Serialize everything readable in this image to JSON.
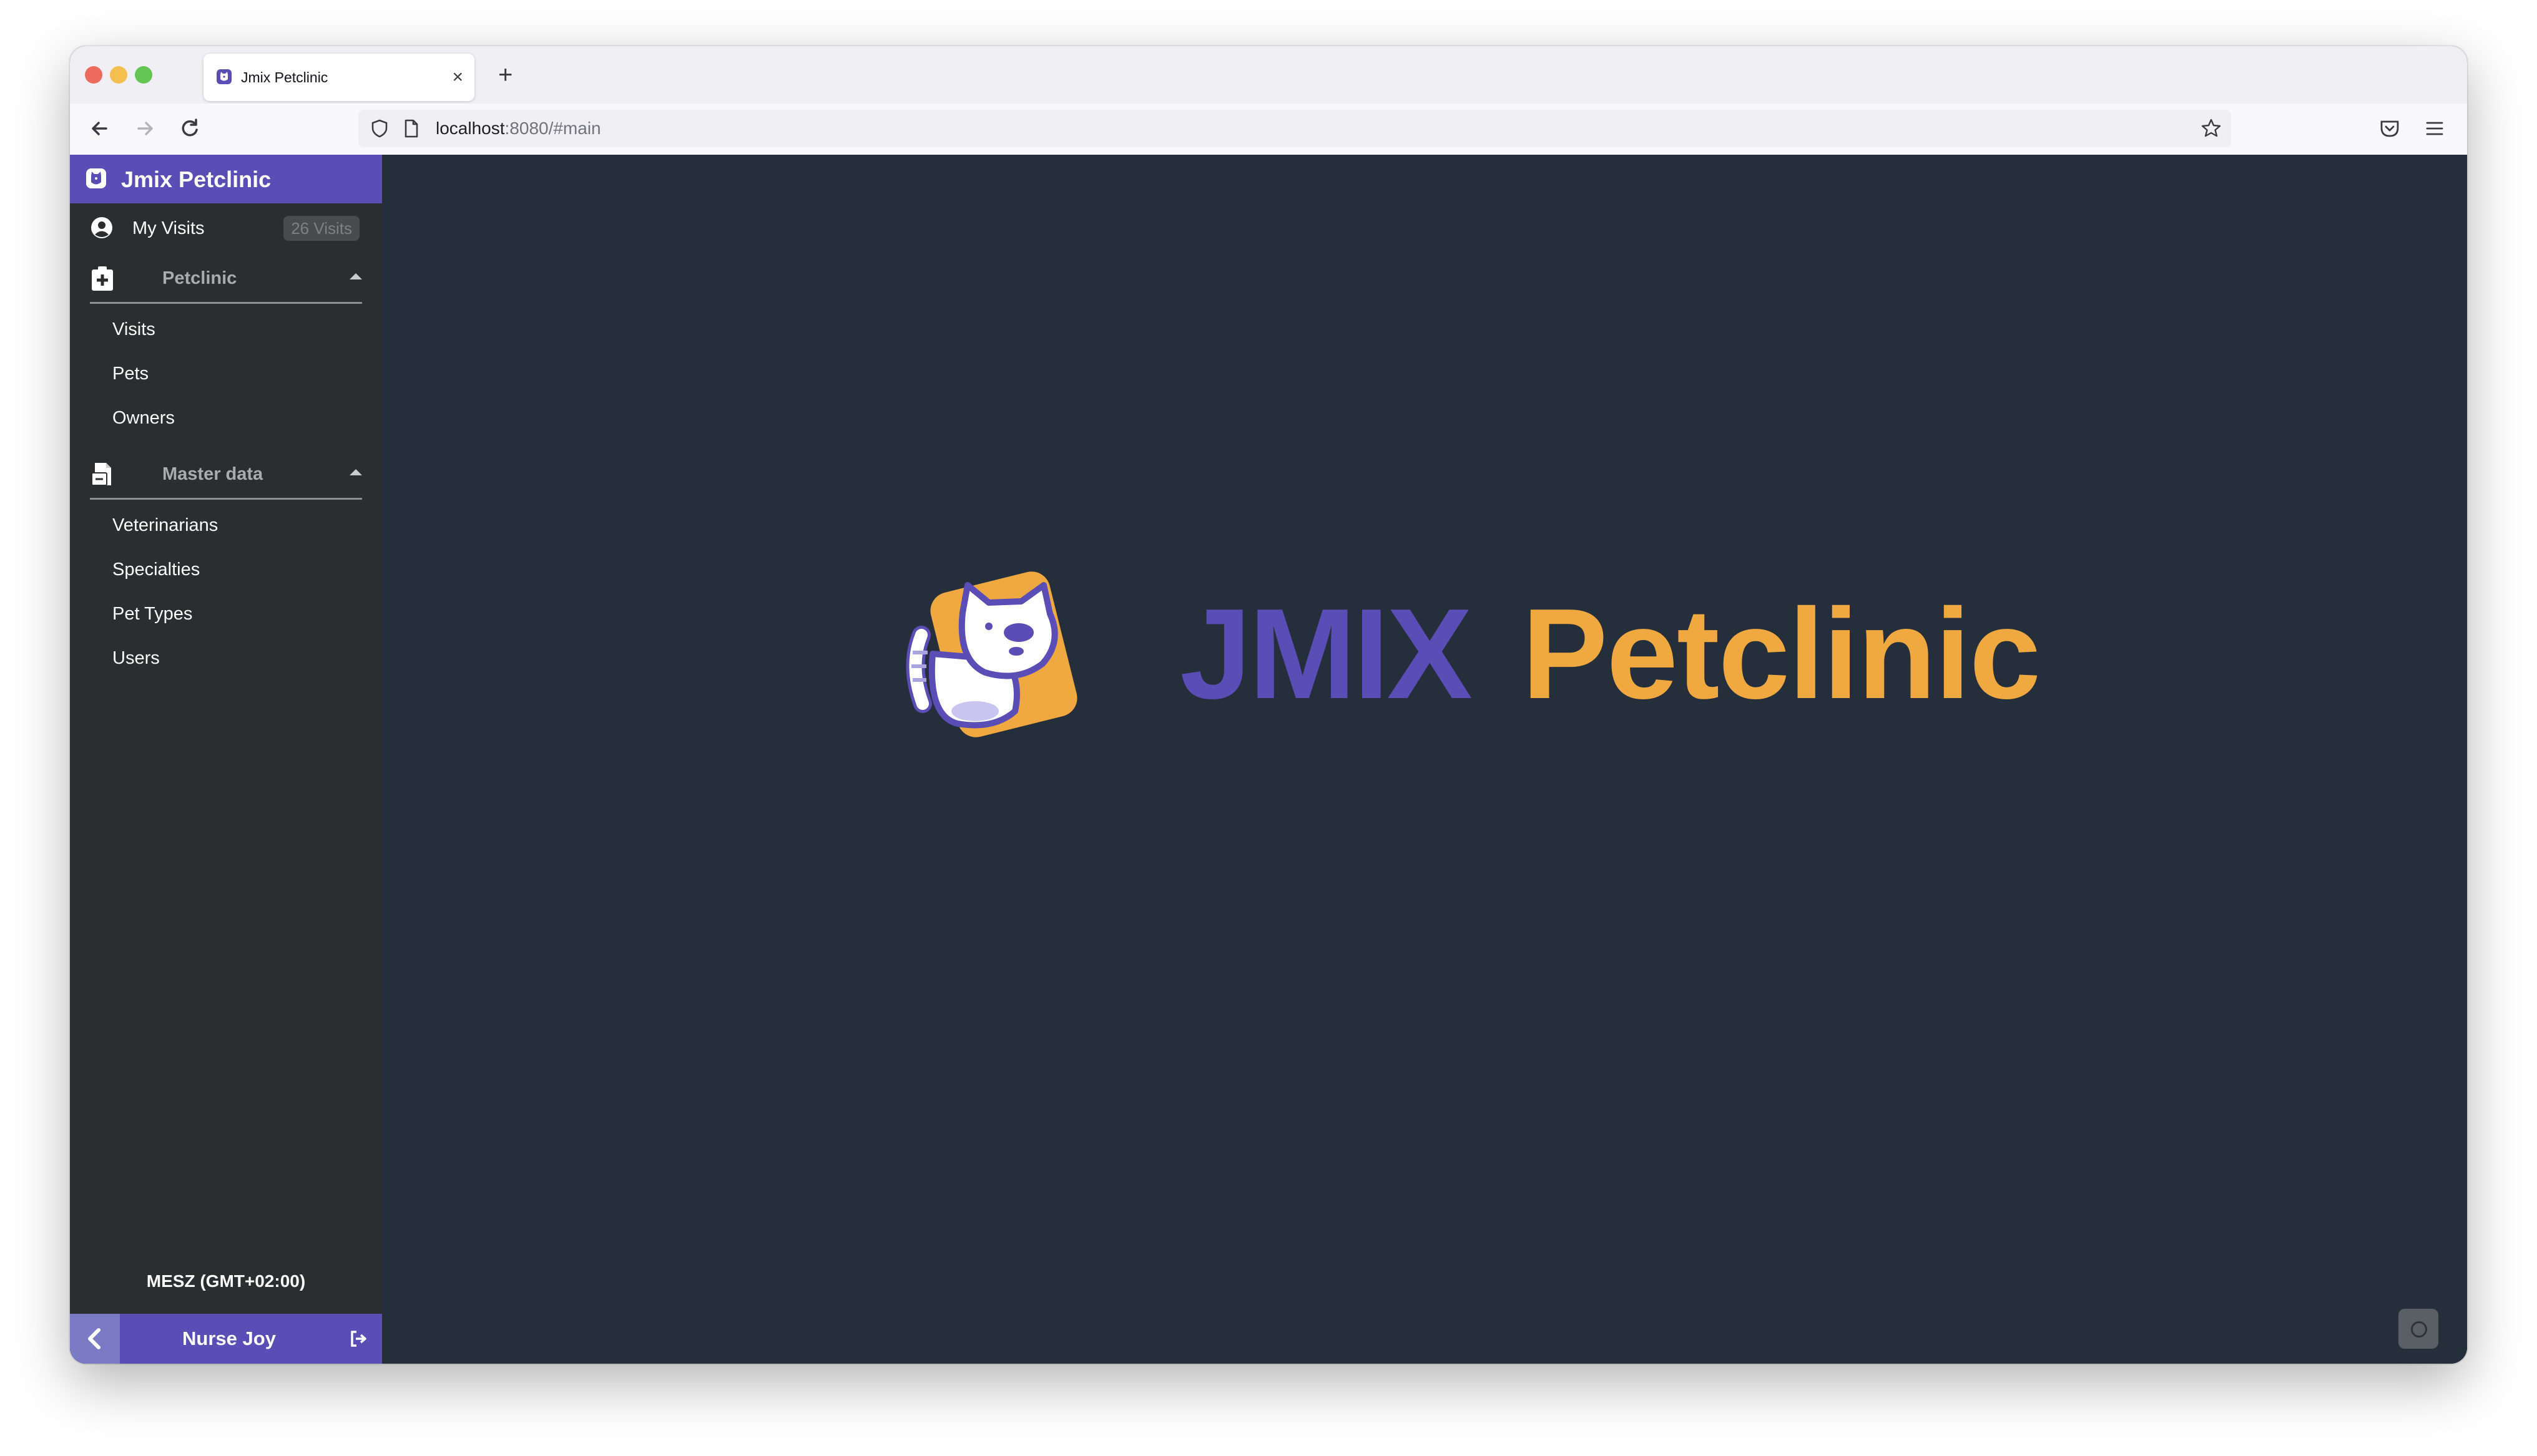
{
  "browser": {
    "tab_title": "Jmix Petclinic",
    "tab_close": "×",
    "new_tab": "+",
    "url_host": "localhost",
    "url_rest": ":8080/#main"
  },
  "sidebar": {
    "app_title": "Jmix Petclinic",
    "my_visits": {
      "label": "My Visits",
      "badge": "26 Visits"
    },
    "groups": [
      {
        "label": "Petclinic",
        "items": [
          "Visits",
          "Pets",
          "Owners"
        ]
      },
      {
        "label": "Master data",
        "items": [
          "Veterinarians",
          "Specialties",
          "Pet Types",
          "Users"
        ]
      }
    ],
    "timezone": "MESZ (GMT+02:00)",
    "user": "Nurse Joy"
  },
  "main": {
    "brand_primary": "JMIX",
    "brand_secondary": "Petclinic"
  },
  "colors": {
    "accent_purple": "#5b4db6",
    "accent_orange": "#efa940",
    "main_background": "#252e3b",
    "sidebar_background": "#2c2d2f"
  }
}
